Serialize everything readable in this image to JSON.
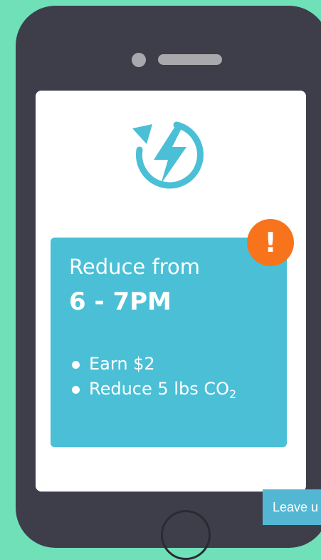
{
  "colors": {
    "background": "#6fe0b8",
    "phone_body": "#3e3e4a",
    "accent": "#4bbfd6",
    "alert": "#f7741c"
  },
  "app_icon": {
    "name": "energy-cycle-icon"
  },
  "card": {
    "line1": "Reduce from",
    "line2": "6 - 7PM",
    "bullets": [
      {
        "text": "Earn $2"
      },
      {
        "text_before_sub": "Reduce 5 lbs CO",
        "subscript": "2"
      }
    ]
  },
  "alert_badge": {
    "symbol": "!"
  },
  "feedback_tab": {
    "label": "Leave u"
  }
}
